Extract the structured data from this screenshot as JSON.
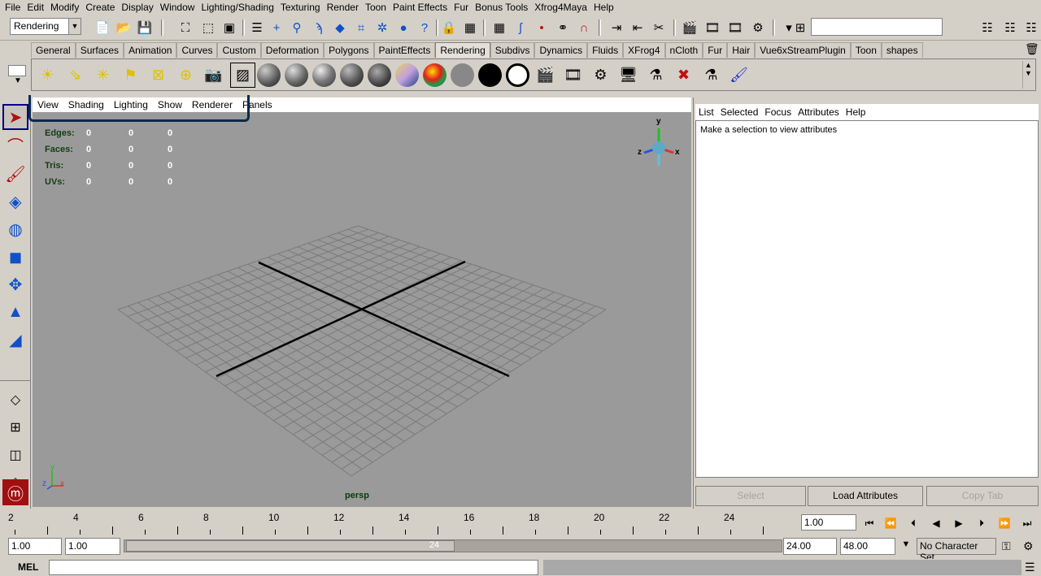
{
  "menubar": [
    "File",
    "Edit",
    "Modify",
    "Create",
    "Display",
    "Window",
    "Lighting/Shading",
    "Texturing",
    "Render",
    "Toon",
    "Paint Effects",
    "Fur",
    "Bonus Tools",
    "Xfrog4Maya",
    "Help"
  ],
  "statusline": {
    "mode": "Rendering"
  },
  "shelf": {
    "tabs": [
      "General",
      "Surfaces",
      "Animation",
      "Curves",
      "Custom",
      "Deformation",
      "Polygons",
      "PaintEffects",
      "Rendering",
      "Subdivs",
      "Dynamics",
      "Fluids",
      "XFrog4",
      "nCloth",
      "Fur",
      "Hair",
      "Vue6xStreamPlugin",
      "Toon",
      "shapes"
    ],
    "active_tab": "Rendering",
    "colors": {
      "black_shader": "#000000"
    }
  },
  "viewport": {
    "menu": [
      "View",
      "Shading",
      "Lighting",
      "Show",
      "Renderer",
      "Panels"
    ],
    "hud": [
      {
        "label": "Edges:",
        "values": [
          "0",
          "0",
          "0"
        ]
      },
      {
        "label": "Faces:",
        "values": [
          "0",
          "0",
          "0"
        ]
      },
      {
        "label": "Tris:",
        "values": [
          "0",
          "0",
          "0"
        ]
      },
      {
        "label": "UVs:",
        "values": [
          "0",
          "0",
          "0"
        ]
      }
    ],
    "camera": "persp",
    "gizmo": {
      "x": "x",
      "y": "y",
      "z": "z"
    },
    "axis": {
      "x": "x",
      "y": "y",
      "z": "z"
    }
  },
  "attribute_editor": {
    "menu": [
      "List",
      "Selected",
      "Focus",
      "Attributes",
      "Help"
    ],
    "message": "Make a selection to view attributes",
    "buttons": {
      "select": "Select",
      "load": "Load Attributes",
      "copy_tab": "Copy Tab"
    }
  },
  "timeslider": {
    "labels": [
      "2",
      "4",
      "6",
      "8",
      "10",
      "12",
      "14",
      "16",
      "18",
      "20",
      "22",
      "24"
    ],
    "current_frame": "1.00"
  },
  "rangeslider": {
    "start": "1.00",
    "playback_start": "1.00",
    "thumb_end": "24",
    "playback_end": "24.00",
    "end": "48.00",
    "character_set": "No Character Set"
  },
  "commandline": {
    "label": "MEL"
  }
}
